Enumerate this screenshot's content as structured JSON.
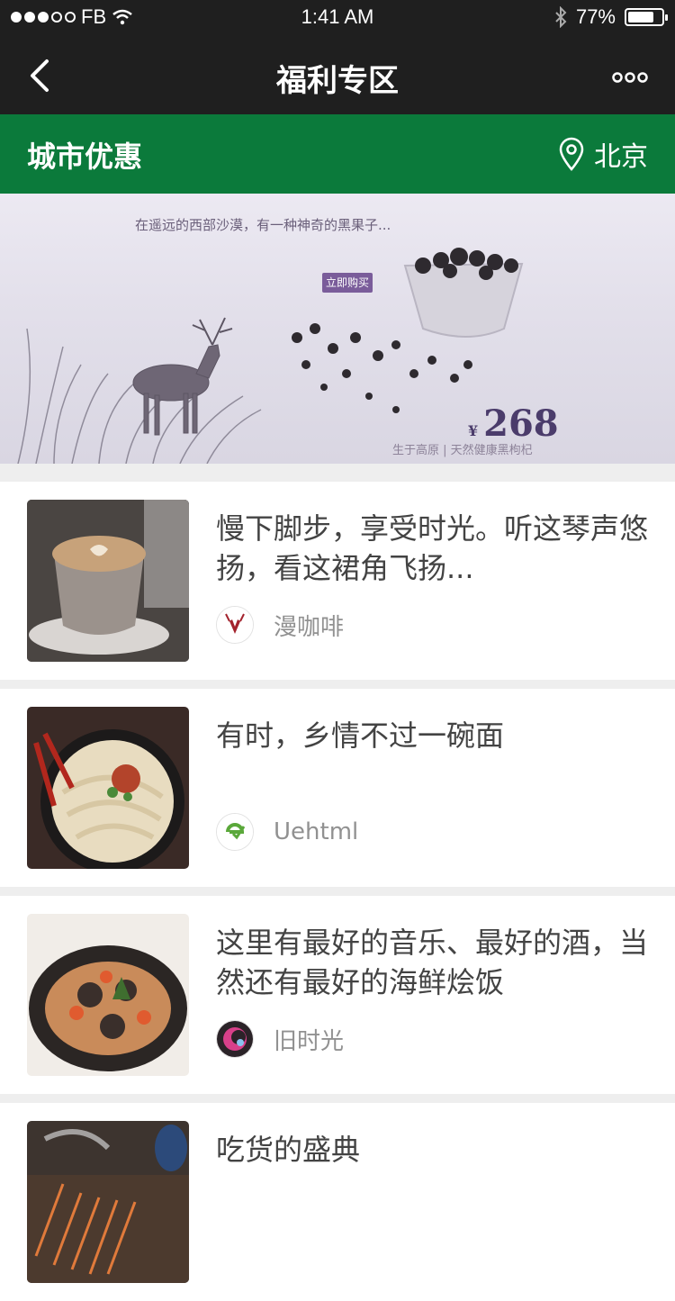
{
  "status_bar": {
    "carrier": "FB",
    "time": "1:41 AM",
    "battery": "77%",
    "battery_level": 0.77
  },
  "navbar": {
    "title": "福利专区",
    "back_icon": "chevron-left-icon",
    "more_icon": "more-icon"
  },
  "city_header": {
    "title": "城市优惠",
    "location_icon": "location-pin-icon",
    "city": "北京"
  },
  "banner": {
    "tagline": "在遥远的西部沙漠，有一种神奇的黑果子...",
    "buy_label": "立即购买",
    "currency": "¥",
    "price": "268",
    "subtitle": "生于高原 | 天然健康黑枸杞"
  },
  "articles": [
    {
      "title": "慢下脚步，享受时光。听这琴声悠扬，看这裙角飞扬...",
      "author": "漫咖啡"
    },
    {
      "title": "有时，乡情不过一碗面",
      "author": "Uehtml"
    },
    {
      "title": "这里有最好的音乐、最好的酒，当然还有最好的海鲜烩饭",
      "author": "旧时光"
    },
    {
      "title": "吃货的盛典",
      "author": ""
    }
  ],
  "colors": {
    "nav_bg": "#1f1f1f",
    "city_bg": "#0b7a3b",
    "page_bg": "#EEEEEE",
    "title_text": "#434343",
    "author_text": "#919191",
    "avatar_border": "#E2E2E2"
  }
}
